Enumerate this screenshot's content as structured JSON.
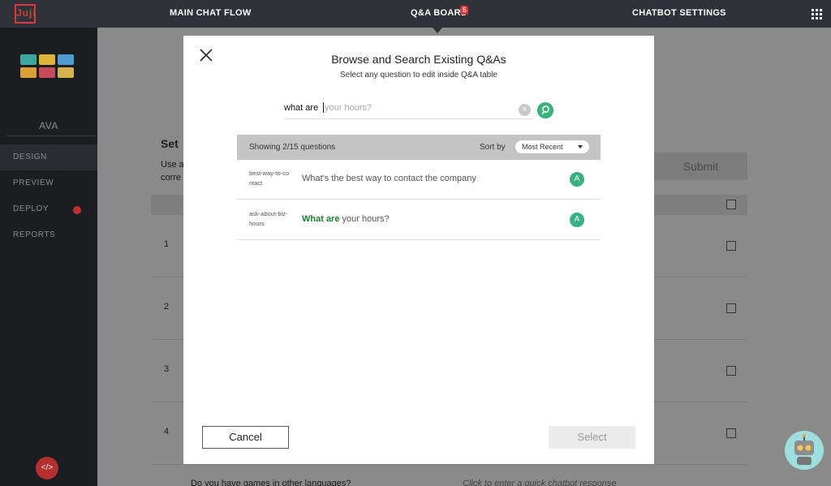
{
  "logo": "Juji",
  "nav": {
    "main_chat_flow": "MAIN CHAT FLOW",
    "qa_board": "Q&A BOARD",
    "qa_badge": "5",
    "chatbot_settings": "CHATBOT SETTINGS",
    "grid_icon": "apps-grid-icon"
  },
  "sidebar": {
    "name": "AVA",
    "items": [
      {
        "label": "DESIGN",
        "active": true
      },
      {
        "label": "PREVIEW",
        "active": false
      },
      {
        "label": "DEPLOY",
        "active": false,
        "status": "alert"
      },
      {
        "label": "REPORTS",
        "active": false
      }
    ],
    "code_icon": "</>"
  },
  "background": {
    "set_heading": "Set",
    "use_text": "Use a",
    "corr_text": "corre",
    "submit": "Submit",
    "row_numbers": [
      "1",
      "2",
      "3",
      "4"
    ],
    "bottom_question": "Do you have games in other languages?",
    "bottom_response": "Click to enter a quick chatbot response"
  },
  "modal": {
    "title": "Browse and Search Existing Q&As",
    "subtitle": "Select any question to edit inside Q&A table",
    "search": {
      "typed": "what are",
      "hint": "your hours?"
    },
    "list": {
      "showing": "Showing 2/15 questions",
      "sort_by_label": "Sort by",
      "sort_value": "Most Recent"
    },
    "questions": [
      {
        "id": "best-way-to-contact",
        "text": "What's the best way to contact the company",
        "match": "",
        "rest": "What's the best way to contact the company",
        "badge": "A"
      },
      {
        "id": "ask-about-biz-hours",
        "text": "What are your hours?",
        "match": "What are",
        "rest": " your hours?",
        "badge": "A"
      }
    ],
    "cancel": "Cancel",
    "select": "Select"
  },
  "colors": {
    "accent_green": "#36b37e",
    "brand_red": "#d9393c",
    "nav_dark": "#2f3238"
  }
}
